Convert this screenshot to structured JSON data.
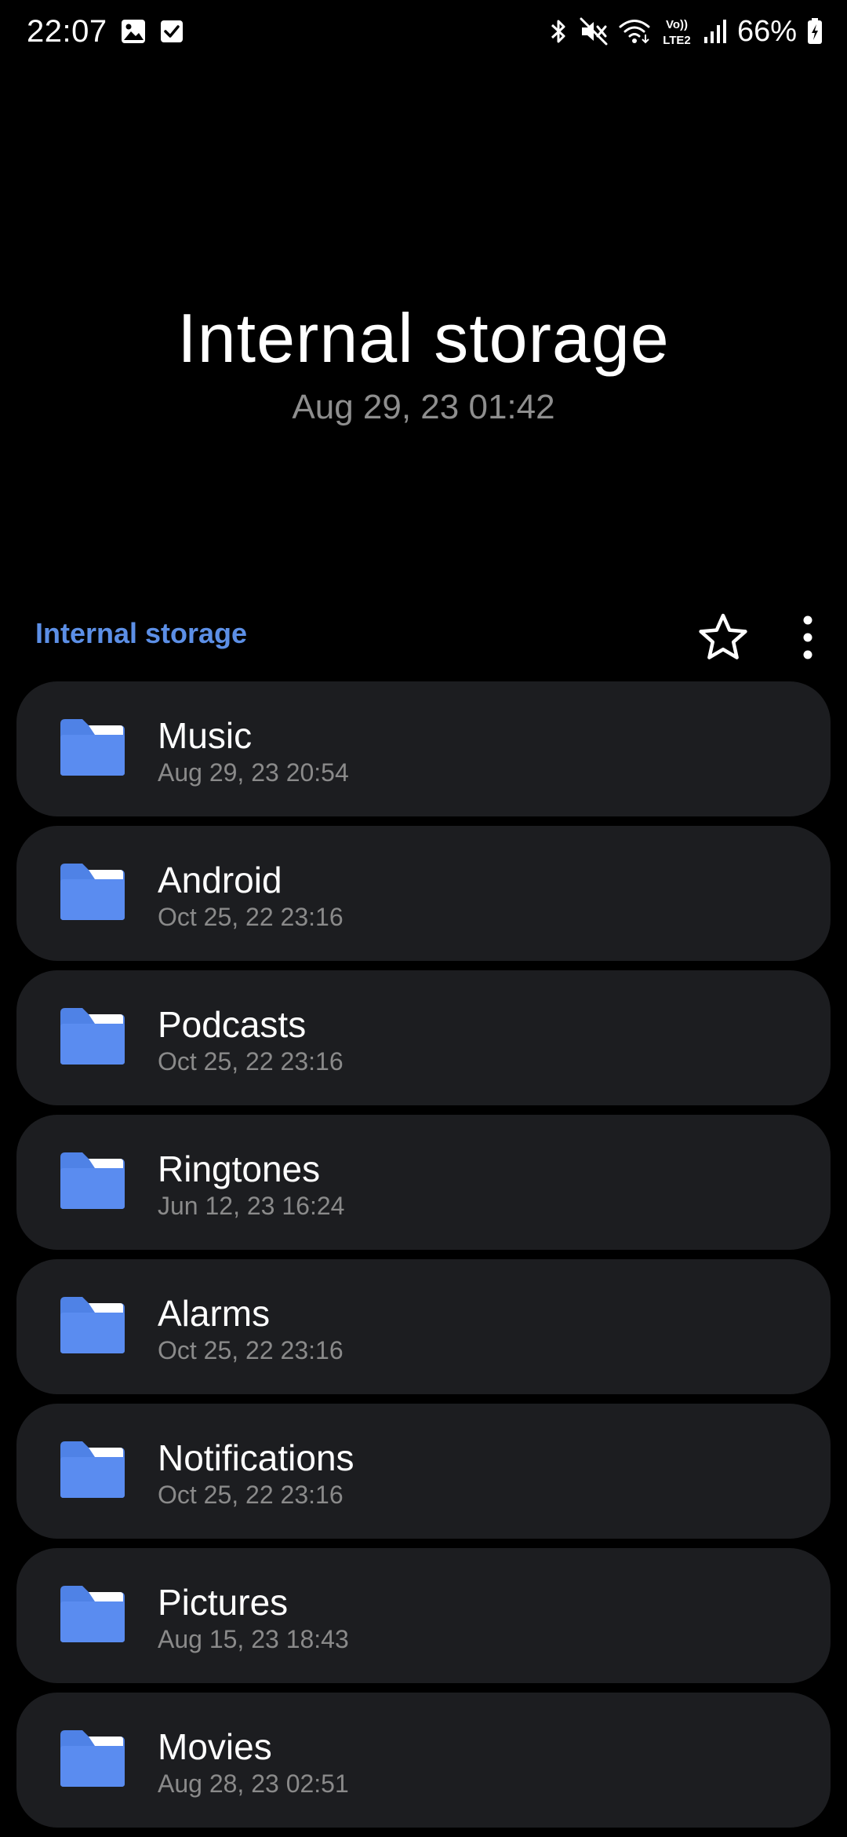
{
  "status_bar": {
    "time": "22:07",
    "battery": "66%",
    "left_icons": [
      "image-notification-icon",
      "checkbox-notification-icon"
    ],
    "right_icons": [
      "bluetooth-icon",
      "mute-icon",
      "wifi-icon",
      "volte-lte2-icon",
      "signal-icon",
      "battery-charging-icon"
    ],
    "volte_label": "Vo))",
    "lte_label": "LTE2"
  },
  "header": {
    "title": "Internal storage",
    "subtitle": "Aug 29, 23 01:42"
  },
  "toolbar": {
    "path_label": "Internal storage",
    "favorite_icon": "star-outline-icon",
    "more_icon": "more-vertical-icon"
  },
  "colors": {
    "accent": "#5c8fe6",
    "folder_icon": "#4f82e6",
    "card_background": "#1c1d20",
    "secondary_text": "#8a8a8a"
  },
  "folders": [
    {
      "name": "Music",
      "date": "Aug 29, 23 20:54"
    },
    {
      "name": "Android",
      "date": "Oct 25, 22 23:16"
    },
    {
      "name": "Podcasts",
      "date": "Oct 25, 22 23:16"
    },
    {
      "name": "Ringtones",
      "date": "Jun 12, 23 16:24"
    },
    {
      "name": "Alarms",
      "date": "Oct 25, 22 23:16"
    },
    {
      "name": "Notifications",
      "date": "Oct 25, 22 23:16"
    },
    {
      "name": "Pictures",
      "date": "Aug 15, 23 18:43"
    },
    {
      "name": "Movies",
      "date": "Aug 28, 23 02:51"
    }
  ]
}
